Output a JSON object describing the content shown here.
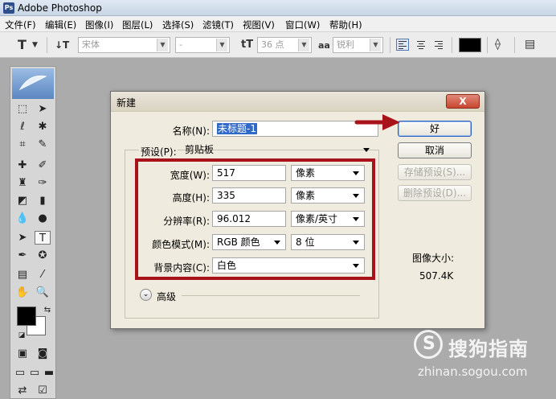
{
  "app": {
    "title": "Adobe Photoshop"
  },
  "menu": [
    "文件(F)",
    "编辑(E)",
    "图像(I)",
    "图层(L)",
    "选择(S)",
    "滤镜(T)",
    "视图(V)",
    "窗口(W)",
    "帮助(H)"
  ],
  "options": {
    "font_family": "宋体",
    "font_style": "-",
    "font_size": "36 点",
    "antialias_icon": "aa",
    "antialias": "锐利",
    "text_color": "#000000"
  },
  "dialog": {
    "title": "新建",
    "close_label": "X",
    "name_label": "名称(N):",
    "name_value": "未标题-1",
    "preset_label": "预设(P):",
    "preset_value": "剪贴板",
    "width_label": "宽度(W):",
    "width_value": "517",
    "width_unit": "像素",
    "height_label": "高度(H):",
    "height_value": "335",
    "height_unit": "像素",
    "resolution_label": "分辨率(R):",
    "resolution_value": "96.012",
    "resolution_unit": "像素/英寸",
    "color_mode_label": "颜色模式(M):",
    "color_mode_value": "RGB 颜色",
    "bit_depth_value": "8 位",
    "background_label": "背景内容(C):",
    "background_value": "白色",
    "advanced_label": "高级",
    "ok_label": "好",
    "cancel_label": "取消",
    "save_preset_label": "存储预设(S)...",
    "delete_preset_label": "删除预设(D)...",
    "image_size_label": "图像大小:",
    "image_size_value": "507.4K"
  },
  "watermark": {
    "brand": "搜狗指南",
    "url": "zhinan.sogou.com"
  },
  "colors": {
    "highlight_box": "#a8121b",
    "selection": "#3169c6"
  }
}
